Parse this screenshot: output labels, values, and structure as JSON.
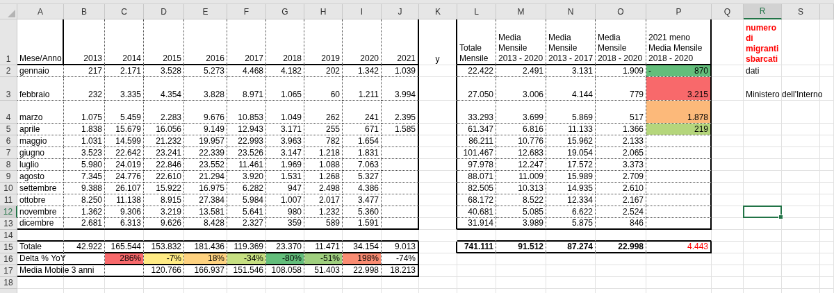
{
  "columns": [
    {
      "label": "A",
      "selected": false
    },
    {
      "label": "B",
      "selected": false
    },
    {
      "label": "C",
      "selected": false
    },
    {
      "label": "D",
      "selected": false
    },
    {
      "label": "E",
      "selected": false
    },
    {
      "label": "F",
      "selected": false
    },
    {
      "label": "G",
      "selected": false
    },
    {
      "label": "H",
      "selected": false
    },
    {
      "label": "I",
      "selected": false
    },
    {
      "label": "J",
      "selected": false
    },
    {
      "label": "K",
      "selected": false
    },
    {
      "label": "L",
      "selected": false
    },
    {
      "label": "M",
      "selected": false
    },
    {
      "label": "N",
      "selected": false
    },
    {
      "label": "O",
      "selected": false
    },
    {
      "label": "P",
      "selected": false
    },
    {
      "label": "Q",
      "selected": false
    },
    {
      "label": "R",
      "selected": true
    },
    {
      "label": "S",
      "selected": false
    }
  ],
  "rows": [
    {
      "number": "1",
      "selected": false,
      "cells": [
        {
          "text": "Mese/Anno",
          "kind": "text"
        },
        {
          "text": "2013",
          "kind": "number"
        },
        {
          "text": "2014",
          "kind": "number"
        },
        {
          "text": "2015",
          "kind": "number"
        },
        {
          "text": "2016",
          "kind": "number"
        },
        {
          "text": "2017",
          "kind": "number"
        },
        {
          "text": "2018",
          "kind": "number"
        },
        {
          "text": "2019",
          "kind": "number"
        },
        {
          "text": "2020",
          "kind": "number"
        },
        {
          "text": "2021",
          "kind": "number"
        },
        {
          "text": "y",
          "kind": "symbol"
        },
        {
          "text": "Totale\nMensile",
          "kind": "text"
        },
        {
          "text": "Media\nMensile\n2013 - 2020",
          "kind": "text"
        },
        {
          "text": "Media\nMensile\n2013 - 2017",
          "kind": "text"
        },
        {
          "text": "Media\nMensile\n2018 - 2020",
          "kind": "text"
        },
        {
          "text": "2021 meno\nMedia Mensile\n2018 - 2020",
          "kind": "text"
        },
        {},
        {
          "text": "numero\ndi\nmigranti\nsbarcati",
          "kind": "text",
          "bold": true,
          "alert": true
        }
      ]
    },
    {
      "number": "2",
      "selected": false,
      "cells": [
        {
          "text": "gennaio",
          "kind": "text"
        },
        {
          "text": "217",
          "kind": "number"
        },
        {
          "text": "2.171",
          "kind": "number"
        },
        {
          "text": "3.528",
          "kind": "number"
        },
        {
          "text": "5.273",
          "kind": "number"
        },
        {
          "text": "4.468",
          "kind": "number"
        },
        {
          "text": "4.182",
          "kind": "number"
        },
        {
          "text": "202",
          "kind": "number"
        },
        {
          "text": "1.342",
          "kind": "number"
        },
        {
          "text": "1.039",
          "kind": "number"
        },
        {},
        {
          "text": "22.422",
          "kind": "number"
        },
        {
          "text": "2.491",
          "kind": "number"
        },
        {
          "text": "3.131",
          "kind": "number"
        },
        {
          "text": "1.909",
          "kind": "number"
        },
        {
          "prefix": "-",
          "text": "870",
          "kind": "number",
          "color": "#63be7b"
        },
        {},
        {
          "text": "dati",
          "kind": "text"
        }
      ]
    },
    {
      "number": "3",
      "selected": false,
      "cells": [
        {
          "text": "febbraio",
          "kind": "text"
        },
        {
          "text": "232",
          "kind": "number"
        },
        {
          "text": "3.335",
          "kind": "number"
        },
        {
          "text": "4.354",
          "kind": "number"
        },
        {
          "text": "3.828",
          "kind": "number"
        },
        {
          "text": "8.971",
          "kind": "number"
        },
        {
          "text": "1.065",
          "kind": "number"
        },
        {
          "text": "60",
          "kind": "number"
        },
        {
          "text": "1.211",
          "kind": "number"
        },
        {
          "text": "3.994",
          "kind": "number"
        },
        {},
        {
          "text": "27.050",
          "kind": "number"
        },
        {
          "text": "3.006",
          "kind": "number"
        },
        {
          "text": "4.144",
          "kind": "number"
        },
        {
          "text": "779",
          "kind": "number"
        },
        {
          "text": "3.215",
          "kind": "number",
          "color": "#f8696b"
        },
        {},
        {
          "text": "Ministero dell'Interno",
          "kind": "text"
        }
      ]
    },
    {
      "number": "4",
      "selected": false,
      "cells": [
        {
          "text": "marzo",
          "kind": "text"
        },
        {
          "text": "1.075",
          "kind": "number"
        },
        {
          "text": "5.459",
          "kind": "number"
        },
        {
          "text": "2.283",
          "kind": "number"
        },
        {
          "text": "9.676",
          "kind": "number"
        },
        {
          "text": "10.853",
          "kind": "number"
        },
        {
          "text": "1.049",
          "kind": "number"
        },
        {
          "text": "262",
          "kind": "number"
        },
        {
          "text": "241",
          "kind": "number"
        },
        {
          "text": "2.395",
          "kind": "number"
        },
        {},
        {
          "text": "33.293",
          "kind": "number"
        },
        {
          "text": "3.699",
          "kind": "number"
        },
        {
          "text": "5.869",
          "kind": "number"
        },
        {
          "text": "517",
          "kind": "number"
        },
        {
          "text": "1.878",
          "kind": "number",
          "color": "#fcb97a"
        }
      ]
    },
    {
      "number": "5",
      "selected": false,
      "cells": [
        {
          "text": "aprile",
          "kind": "text"
        },
        {
          "text": "1.838",
          "kind": "number"
        },
        {
          "text": "15.679",
          "kind": "number"
        },
        {
          "text": "16.056",
          "kind": "number"
        },
        {
          "text": "9.149",
          "kind": "number"
        },
        {
          "text": "12.943",
          "kind": "number"
        },
        {
          "text": "3.171",
          "kind": "number"
        },
        {
          "text": "255",
          "kind": "number"
        },
        {
          "text": "671",
          "kind": "number"
        },
        {
          "text": "1.585",
          "kind": "number"
        },
        {},
        {
          "text": "61.347",
          "kind": "number"
        },
        {
          "text": "6.816",
          "kind": "number"
        },
        {
          "text": "11.133",
          "kind": "number"
        },
        {
          "text": "1.366",
          "kind": "number"
        },
        {
          "text": "219",
          "kind": "number",
          "color": "#b5d67c"
        }
      ]
    },
    {
      "number": "6",
      "selected": false,
      "cells": [
        {
          "text": "maggio",
          "kind": "text"
        },
        {
          "text": "1.031",
          "kind": "number"
        },
        {
          "text": "14.599",
          "kind": "number"
        },
        {
          "text": "21.232",
          "kind": "number"
        },
        {
          "text": "19.957",
          "kind": "number"
        },
        {
          "text": "22.993",
          "kind": "number"
        },
        {
          "text": "3.963",
          "kind": "number"
        },
        {
          "text": "782",
          "kind": "number"
        },
        {
          "text": "1.654",
          "kind": "number"
        },
        {},
        {},
        {
          "text": "86.211",
          "kind": "number"
        },
        {
          "text": "10.776",
          "kind": "number"
        },
        {
          "text": "15.962",
          "kind": "number"
        },
        {
          "text": "2.133",
          "kind": "number"
        }
      ]
    },
    {
      "number": "7",
      "selected": false,
      "cells": [
        {
          "text": "giugno",
          "kind": "text"
        },
        {
          "text": "3.523",
          "kind": "number"
        },
        {
          "text": "22.642",
          "kind": "number"
        },
        {
          "text": "23.241",
          "kind": "number"
        },
        {
          "text": "22.339",
          "kind": "number"
        },
        {
          "text": "23.526",
          "kind": "number"
        },
        {
          "text": "3.147",
          "kind": "number"
        },
        {
          "text": "1.218",
          "kind": "number"
        },
        {
          "text": "1.831",
          "kind": "number"
        },
        {},
        {},
        {
          "text": "101.467",
          "kind": "number"
        },
        {
          "text": "12.683",
          "kind": "number"
        },
        {
          "text": "19.054",
          "kind": "number"
        },
        {
          "text": "2.065",
          "kind": "number"
        }
      ]
    },
    {
      "number": "8",
      "selected": false,
      "cells": [
        {
          "text": "luglio",
          "kind": "text"
        },
        {
          "text": "5.980",
          "kind": "number"
        },
        {
          "text": "24.019",
          "kind": "number"
        },
        {
          "text": "22.846",
          "kind": "number"
        },
        {
          "text": "23.552",
          "kind": "number"
        },
        {
          "text": "11.461",
          "kind": "number"
        },
        {
          "text": "1.969",
          "kind": "number"
        },
        {
          "text": "1.088",
          "kind": "number"
        },
        {
          "text": "7.063",
          "kind": "number"
        },
        {},
        {},
        {
          "text": "97.978",
          "kind": "number"
        },
        {
          "text": "12.247",
          "kind": "number"
        },
        {
          "text": "17.572",
          "kind": "number"
        },
        {
          "text": "3.373",
          "kind": "number"
        }
      ]
    },
    {
      "number": "9",
      "selected": false,
      "cells": [
        {
          "text": "agosto",
          "kind": "text"
        },
        {
          "text": "7.345",
          "kind": "number"
        },
        {
          "text": "24.776",
          "kind": "number"
        },
        {
          "text": "22.610",
          "kind": "number"
        },
        {
          "text": "21.294",
          "kind": "number"
        },
        {
          "text": "3.920",
          "kind": "number"
        },
        {
          "text": "1.531",
          "kind": "number"
        },
        {
          "text": "1.268",
          "kind": "number"
        },
        {
          "text": "5.327",
          "kind": "number"
        },
        {},
        {},
        {
          "text": "88.071",
          "kind": "number"
        },
        {
          "text": "11.009",
          "kind": "number"
        },
        {
          "text": "15.989",
          "kind": "number"
        },
        {
          "text": "2.709",
          "kind": "number"
        }
      ]
    },
    {
      "number": "10",
      "selected": false,
      "cells": [
        {
          "text": "settembre",
          "kind": "text"
        },
        {
          "text": "9.388",
          "kind": "number"
        },
        {
          "text": "26.107",
          "kind": "number"
        },
        {
          "text": "15.922",
          "kind": "number"
        },
        {
          "text": "16.975",
          "kind": "number"
        },
        {
          "text": "6.282",
          "kind": "number"
        },
        {
          "text": "947",
          "kind": "number"
        },
        {
          "text": "2.498",
          "kind": "number"
        },
        {
          "text": "4.386",
          "kind": "number"
        },
        {},
        {},
        {
          "text": "82.505",
          "kind": "number"
        },
        {
          "text": "10.313",
          "kind": "number"
        },
        {
          "text": "14.935",
          "kind": "number"
        },
        {
          "text": "2.610",
          "kind": "number"
        }
      ]
    },
    {
      "number": "11",
      "selected": false,
      "cells": [
        {
          "text": "ottobre",
          "kind": "text"
        },
        {
          "text": "8.250",
          "kind": "number"
        },
        {
          "text": "11.138",
          "kind": "number"
        },
        {
          "text": "8.915",
          "kind": "number"
        },
        {
          "text": "27.384",
          "kind": "number"
        },
        {
          "text": "5.984",
          "kind": "number"
        },
        {
          "text": "1.007",
          "kind": "number"
        },
        {
          "text": "2.017",
          "kind": "number"
        },
        {
          "text": "3.477",
          "kind": "number"
        },
        {},
        {},
        {
          "text": "68.172",
          "kind": "number"
        },
        {
          "text": "8.522",
          "kind": "number"
        },
        {
          "text": "12.334",
          "kind": "number"
        },
        {
          "text": "2.167",
          "kind": "number"
        }
      ]
    },
    {
      "number": "12",
      "selected": true,
      "cells": [
        {
          "text": "novembre",
          "kind": "text"
        },
        {
          "text": "1.362",
          "kind": "number"
        },
        {
          "text": "9.306",
          "kind": "number"
        },
        {
          "text": "3.219",
          "kind": "number"
        },
        {
          "text": "13.581",
          "kind": "number"
        },
        {
          "text": "5.641",
          "kind": "number"
        },
        {
          "text": "980",
          "kind": "number"
        },
        {
          "text": "1.232",
          "kind": "number"
        },
        {
          "text": "5.360",
          "kind": "number"
        },
        {},
        {},
        {
          "text": "40.681",
          "kind": "number"
        },
        {
          "text": "5.085",
          "kind": "number"
        },
        {
          "text": "6.622",
          "kind": "number"
        },
        {
          "text": "2.524",
          "kind": "number"
        },
        {},
        {},
        {
          "selected": true
        }
      ]
    },
    {
      "number": "13",
      "selected": false,
      "cells": [
        {
          "text": "dicembre",
          "kind": "text"
        },
        {
          "text": "2.681",
          "kind": "number"
        },
        {
          "text": "6.313",
          "kind": "number"
        },
        {
          "text": "9.626",
          "kind": "number"
        },
        {
          "text": "8.428",
          "kind": "number"
        },
        {
          "text": "2.327",
          "kind": "number"
        },
        {
          "text": "359",
          "kind": "number"
        },
        {
          "text": "589",
          "kind": "number"
        },
        {
          "text": "1.591",
          "kind": "number"
        },
        {},
        {},
        {
          "text": "31.914",
          "kind": "number"
        },
        {
          "text": "3.989",
          "kind": "number"
        },
        {
          "text": "5.875",
          "kind": "number"
        },
        {
          "text": "846",
          "kind": "number"
        }
      ]
    },
    {
      "number": "14",
      "selected": false
    },
    {
      "number": "15",
      "selected": false,
      "cells": [
        {
          "text": "Totale",
          "kind": "text"
        },
        {
          "text": "42.922",
          "kind": "number"
        },
        {
          "text": "165.544",
          "kind": "number"
        },
        {
          "text": "153.832",
          "kind": "number"
        },
        {
          "text": "181.436",
          "kind": "number"
        },
        {
          "text": "119.369",
          "kind": "number"
        },
        {
          "text": "23.370",
          "kind": "number"
        },
        {
          "text": "11.471",
          "kind": "number"
        },
        {
          "text": "34.154",
          "kind": "number"
        },
        {
          "text": "9.013",
          "kind": "number"
        },
        {},
        {
          "text": "741.111",
          "kind": "number",
          "bold": true
        },
        {
          "text": "91.512",
          "kind": "number",
          "bold": true
        },
        {
          "text": "87.274",
          "kind": "number",
          "bold": true
        },
        {
          "text": "22.998",
          "kind": "number",
          "bold": true
        },
        {
          "text": "4.443",
          "kind": "number",
          "alert": true
        }
      ]
    },
    {
      "number": "16",
      "selected": false,
      "cells": [
        {
          "text": "Delta % YoY",
          "kind": "text"
        },
        {},
        {
          "text": "286%",
          "kind": "number",
          "color": "#f8696b"
        },
        {
          "text": "-7%",
          "kind": "number",
          "color": "#ffeb84"
        },
        {
          "text": "18%",
          "kind": "number",
          "color": "#fed27f"
        },
        {
          "text": "-34%",
          "kind": "number",
          "color": "#c6df81"
        },
        {
          "text": "-80%",
          "kind": "number",
          "color": "#63be7b"
        },
        {
          "text": "-51%",
          "kind": "number",
          "color": "#9fcf7e"
        },
        {
          "text": "198%",
          "kind": "number",
          "color": "#fa8c72"
        },
        {
          "text": "-74%",
          "kind": "number"
        }
      ]
    },
    {
      "number": "17",
      "selected": false,
      "cells": [
        {
          "text": "Media Mobile 3 anni",
          "kind": "text"
        },
        {},
        {},
        {
          "text": "120.766",
          "kind": "number"
        },
        {
          "text": "166.937",
          "kind": "number"
        },
        {
          "text": "151.546",
          "kind": "number"
        },
        {
          "text": "108.058",
          "kind": "number"
        },
        {
          "text": "51.403",
          "kind": "number"
        },
        {
          "text": "22.998",
          "kind": "number"
        },
        {
          "text": "18.213",
          "kind": "number"
        }
      ]
    },
    {
      "number": "18",
      "selected": false
    }
  ]
}
